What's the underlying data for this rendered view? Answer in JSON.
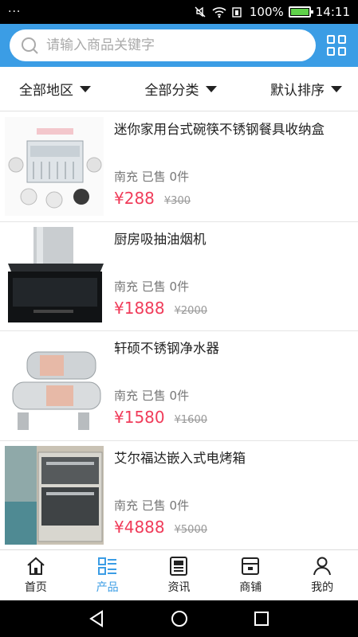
{
  "status_bar": {
    "dots": "···",
    "battery_percent": "100%",
    "time": "14:11",
    "battery_level": 1.0,
    "icons": [
      "mute-icon",
      "wifi-icon",
      "signal-icon",
      "battery-icon"
    ]
  },
  "search": {
    "placeholder": "请输入商品关键字",
    "icon": "search-icon",
    "grid_icon": "grid-menu-icon"
  },
  "filters": [
    {
      "label": "全部地区"
    },
    {
      "label": "全部分类"
    },
    {
      "label": "默认排序"
    }
  ],
  "products": [
    {
      "title": "迷你家用台式碗筷不锈钢餐具收纳盒",
      "meta": "南充 已售 0件",
      "price": "¥288",
      "old_price": "¥300",
      "image": "dish-rack-image"
    },
    {
      "title": "厨房吸抽油烟机",
      "meta": "南充 已售 0件",
      "price": "¥1888",
      "old_price": "¥2000",
      "image": "range-hood-image"
    },
    {
      "title": "轩硕不锈钢净水器",
      "meta": "南充 已售 0件",
      "price": "¥1580",
      "old_price": "¥1600",
      "image": "water-purifier-image"
    },
    {
      "title": "艾尔福达嵌入式电烤箱",
      "meta": "南充 已售 0件",
      "price": "¥4888",
      "old_price": "¥5000",
      "image": "built-in-oven-image"
    }
  ],
  "tabs": [
    {
      "label": "首页",
      "icon": "home-icon"
    },
    {
      "label": "产品",
      "icon": "product-list-icon",
      "active": true
    },
    {
      "label": "资讯",
      "icon": "news-icon"
    },
    {
      "label": "商铺",
      "icon": "shop-icon"
    },
    {
      "label": "我的",
      "icon": "user-icon"
    }
  ],
  "colors": {
    "accent": "#3b9de5",
    "price": "#f03c5a"
  }
}
